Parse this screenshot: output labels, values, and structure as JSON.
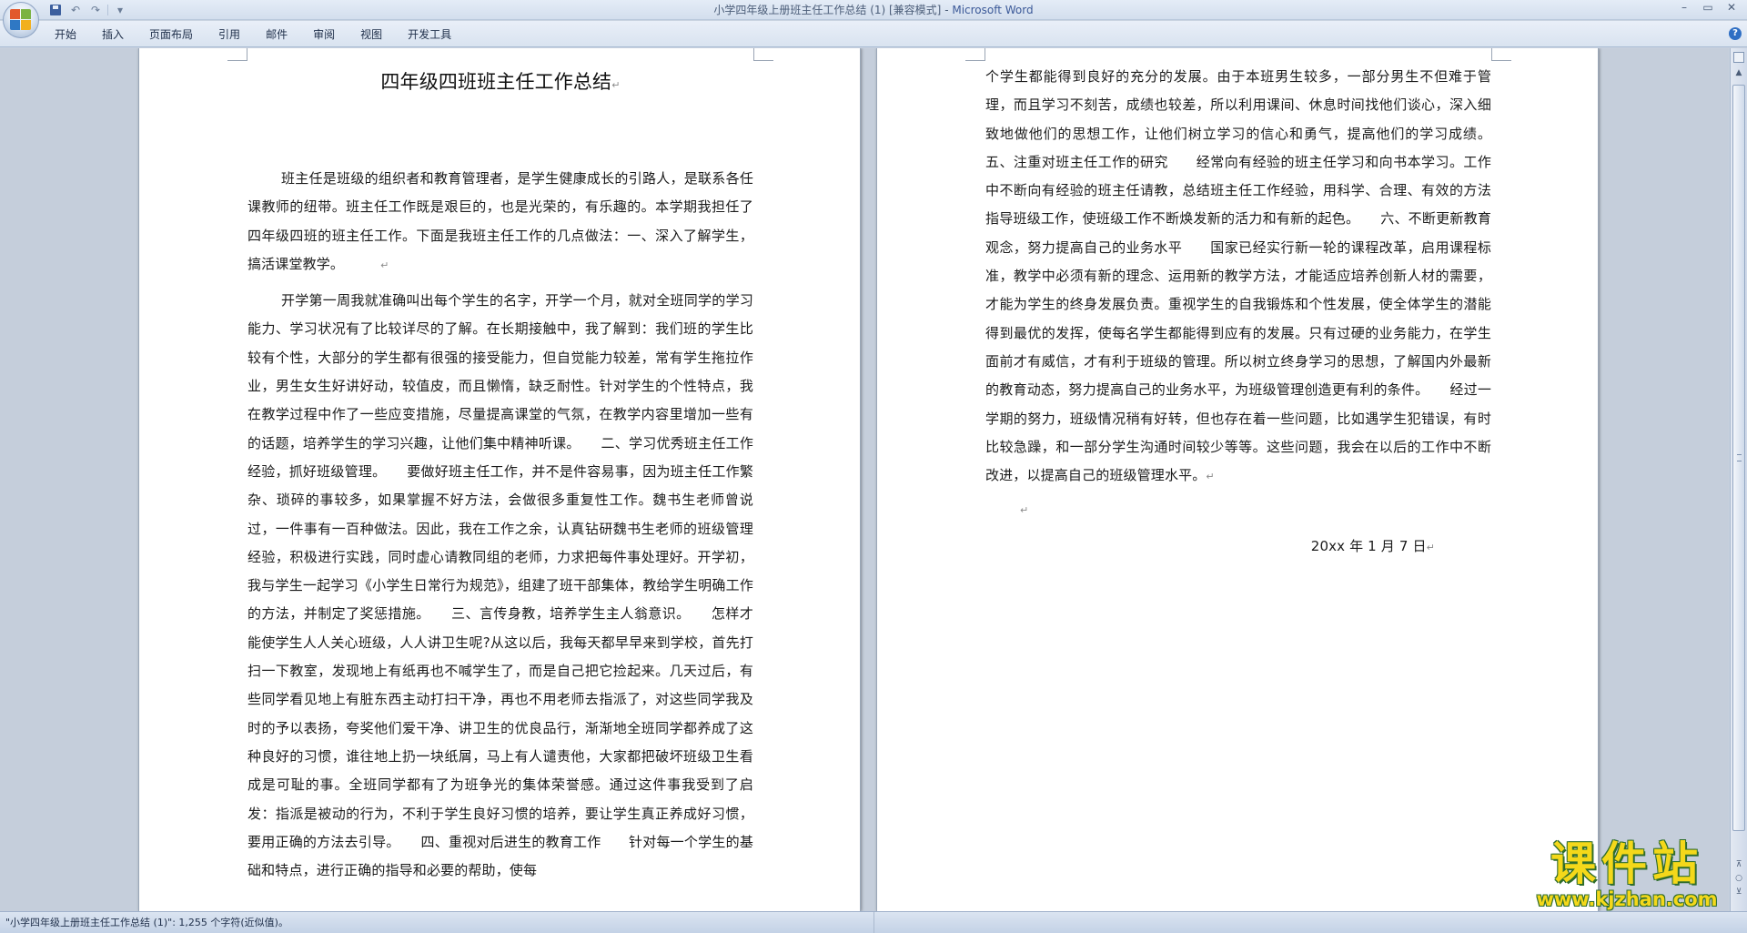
{
  "window": {
    "title_doc": "小学四年级上册班主任工作总结 (1) [兼容模式]",
    "title_sep": " - ",
    "title_app": "Microsoft Word",
    "controls": {
      "minimize": "–",
      "restore": "▭",
      "close": "✕"
    }
  },
  "quick_access": {
    "undo": "↶",
    "redo": "↷",
    "more": "▾"
  },
  "ribbon": {
    "tabs": [
      "开始",
      "插入",
      "页面布局",
      "引用",
      "邮件",
      "审阅",
      "视图",
      "开发工具"
    ],
    "help": "?"
  },
  "document": {
    "title": "四年级四班班主任工作总结",
    "paragraph_mark": "↵",
    "page1_paragraphs": [
      "班主任是班级的组织者和教育管理者，是学生健康成长的引路人，是联系各任课教师的纽带。班主任工作既是艰巨的，也是光荣的，有乐趣的。本学期我担任了四年级四班的班主任工作。下面是我班主任工作的几点做法：一、深入了解学生，搞活课堂教学。",
      "开学第一周我就准确叫出每个学生的名字，开学一个月，就对全班同学的学习能力、学习状况有了比较详尽的了解。在长期接触中，我了解到：我们班的学生比较有个性，大部分的学生都有很强的接受能力，但自觉能力较差，常有学生拖拉作业，男生女生好讲好动，较值皮，而且懒惰，缺乏耐性。针对学生的个性特点，我在教学过程中作了一些应变措施，尽量提高课堂的气氛，在教学内容里增加一些有的话题，培养学生的学习兴趣，让他们集中精神听课。　　二、学习优秀班主任工作经验，抓好班级管理。　　要做好班主任工作，并不是件容易事，因为班主任工作繁杂、琐碎的事较多，如果掌握不好方法，会做很多重复性工作。魏书生老师曾说过，一件事有一百种做法。因此，我在工作之余，认真钻研魏书生老师的班级管理经验，积极进行实践，同时虚心请教同组的老师，力求把每件事处理好。开学初，我与学生一起学习《小学生日常行为规范》，组建了班干部集体，教给学生明确工作的方法，并制定了奖惩措施。　　三、言传身教，培养学生主人翁意识。　　怎样才能使学生人人关心班级，人人讲卫生呢?从这以后，我每天都早早来到学校，首先打扫一下教室，发现地上有纸再也不喊学生了，而是自己把它捡起来。几天过后，有些同学看见地上有脏东西主动打扫干净，再也不用老师去指派了，对这些同学我及时的予以表扬，夸奖他们爱干净、讲卫生的优良品行，渐渐地全班同学都养成了这种良好的习惯，谁往地上扔一块纸屑，马上有人谴责他，大家都把破坏班级卫生看成是可耻的事。全班同学都有了为班争光的集体荣誉感。通过这件事我受到了启发：指派是被动的行为，不利于学生良好习惯的培养，要让学生真正养成好习惯，要用正确的方法去引导。　　四、重视对后进生的教育工作　　针对每一个学生的基础和特点，进行正确的指导和必要的帮助，使每"
    ],
    "page2_paragraphs": [
      "个学生都能得到良好的充分的发展。由于本班男生较多，一部分男生不但难于管理，而且学习不刻苦，成绩也较差，所以利用课间、休息时间找他们谈心，深入细致地做他们的思想工作，让他们树立学习的信心和勇气，提高他们的学习成绩。五、注重对班主任工作的研究　　经常向有经验的班主任学习和向书本学习。工作中不断向有经验的班主任请教，总结班主任工作经验，用科学、合理、有效的方法指导班级工作，使班级工作不断焕发新的活力和有新的起色。　　六、不断更新教育观念，努力提高自己的业务水平　　国家已经实行新一轮的课程改革，启用课程标准，教学中必须有新的理念、运用新的教学方法，才能适应培养创新人材的需要，才能为学生的终身发展负责。重视学生的自我锻炼和个性发展，使全体学生的潜能得到最优的发挥，使每名学生都能得到应有的发展。只有过硬的业务能力，在学生面前才有威信，才有利于班级的管理。所以树立终身学习的思想，了解国内外最新的教育动态，努力提高自己的业务水平，为班级管理创造更有利的条件。　　经过一学期的努力，班级情况稍有好转，但也存在着一些问题，比如遇学生犯错误，有时比较急躁，和一部分学生沟通时间较少等等。这些问题，我会在以后的工作中不断改进，以提高自己的班级管理水平。"
    ],
    "date": "20xx 年 1 月 7 日"
  },
  "statusbar": {
    "text": "\"小学四年级上册班主任工作总结 (1)\": 1,255 个字符(近似值)。"
  },
  "scrollbar": {
    "up": "▲",
    "browse_prev": "⊼",
    "browse_obj": "○",
    "browse_next": "⊻"
  },
  "watermark": {
    "name": "课件站",
    "url": "www.kjzhan.com"
  },
  "colors": {
    "title_app": "#3b5998",
    "workspace_bg": "#c5cedb",
    "watermark_fill": "#f4d81a",
    "watermark_outline": "#2f6d2c"
  },
  "icons": {
    "office_button": "office-logo-icon",
    "save": "save-icon",
    "undo": "undo-icon",
    "redo": "redo-icon",
    "help": "help-icon"
  }
}
